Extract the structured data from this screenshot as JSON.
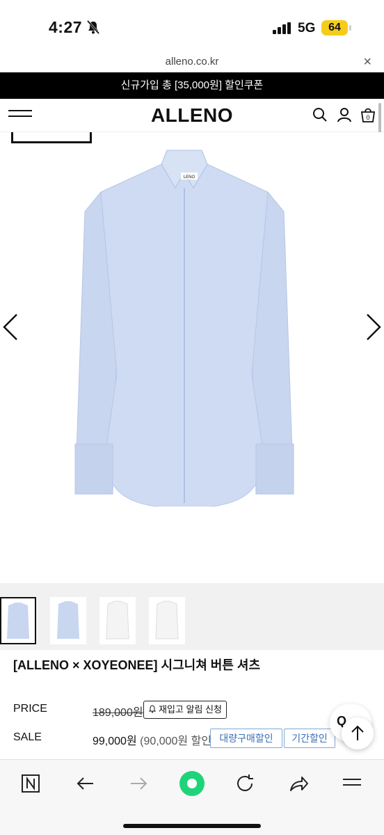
{
  "status_bar": {
    "time": "4:27",
    "network": "5G",
    "battery": "64"
  },
  "browser": {
    "url": "alleno.co.kr",
    "close_label": "×"
  },
  "promo_banner": "신규가입 총 [35,000원] 할인쿠폰",
  "header": {
    "logo": "ALLENO",
    "cart_count": "0"
  },
  "hero": {
    "brand_stamp": "XOYEONEE"
  },
  "thumbnails": {
    "count": 4,
    "active_index": 0
  },
  "product": {
    "title": "[ALLENO × XOYEONEE] 시그니쳐 버튼 셔츠",
    "price_label": "PRICE",
    "price": "189,000원",
    "restock_button": "재입고 알림 신청",
    "sale_label": "SALE",
    "sale_price": "99,000원",
    "sale_discount": "(90,000원 할인)",
    "bulk_button": "대량구매할인",
    "period_button": "기간할인"
  },
  "floating": {
    "chat_text": "Q"
  },
  "colors": {
    "shirt": "#c9d6f0",
    "promo_bg": "#000000",
    "tag_border": "#7fa8d6",
    "battery": "#f5cc1b",
    "reload_accent": "#1fd37a"
  }
}
